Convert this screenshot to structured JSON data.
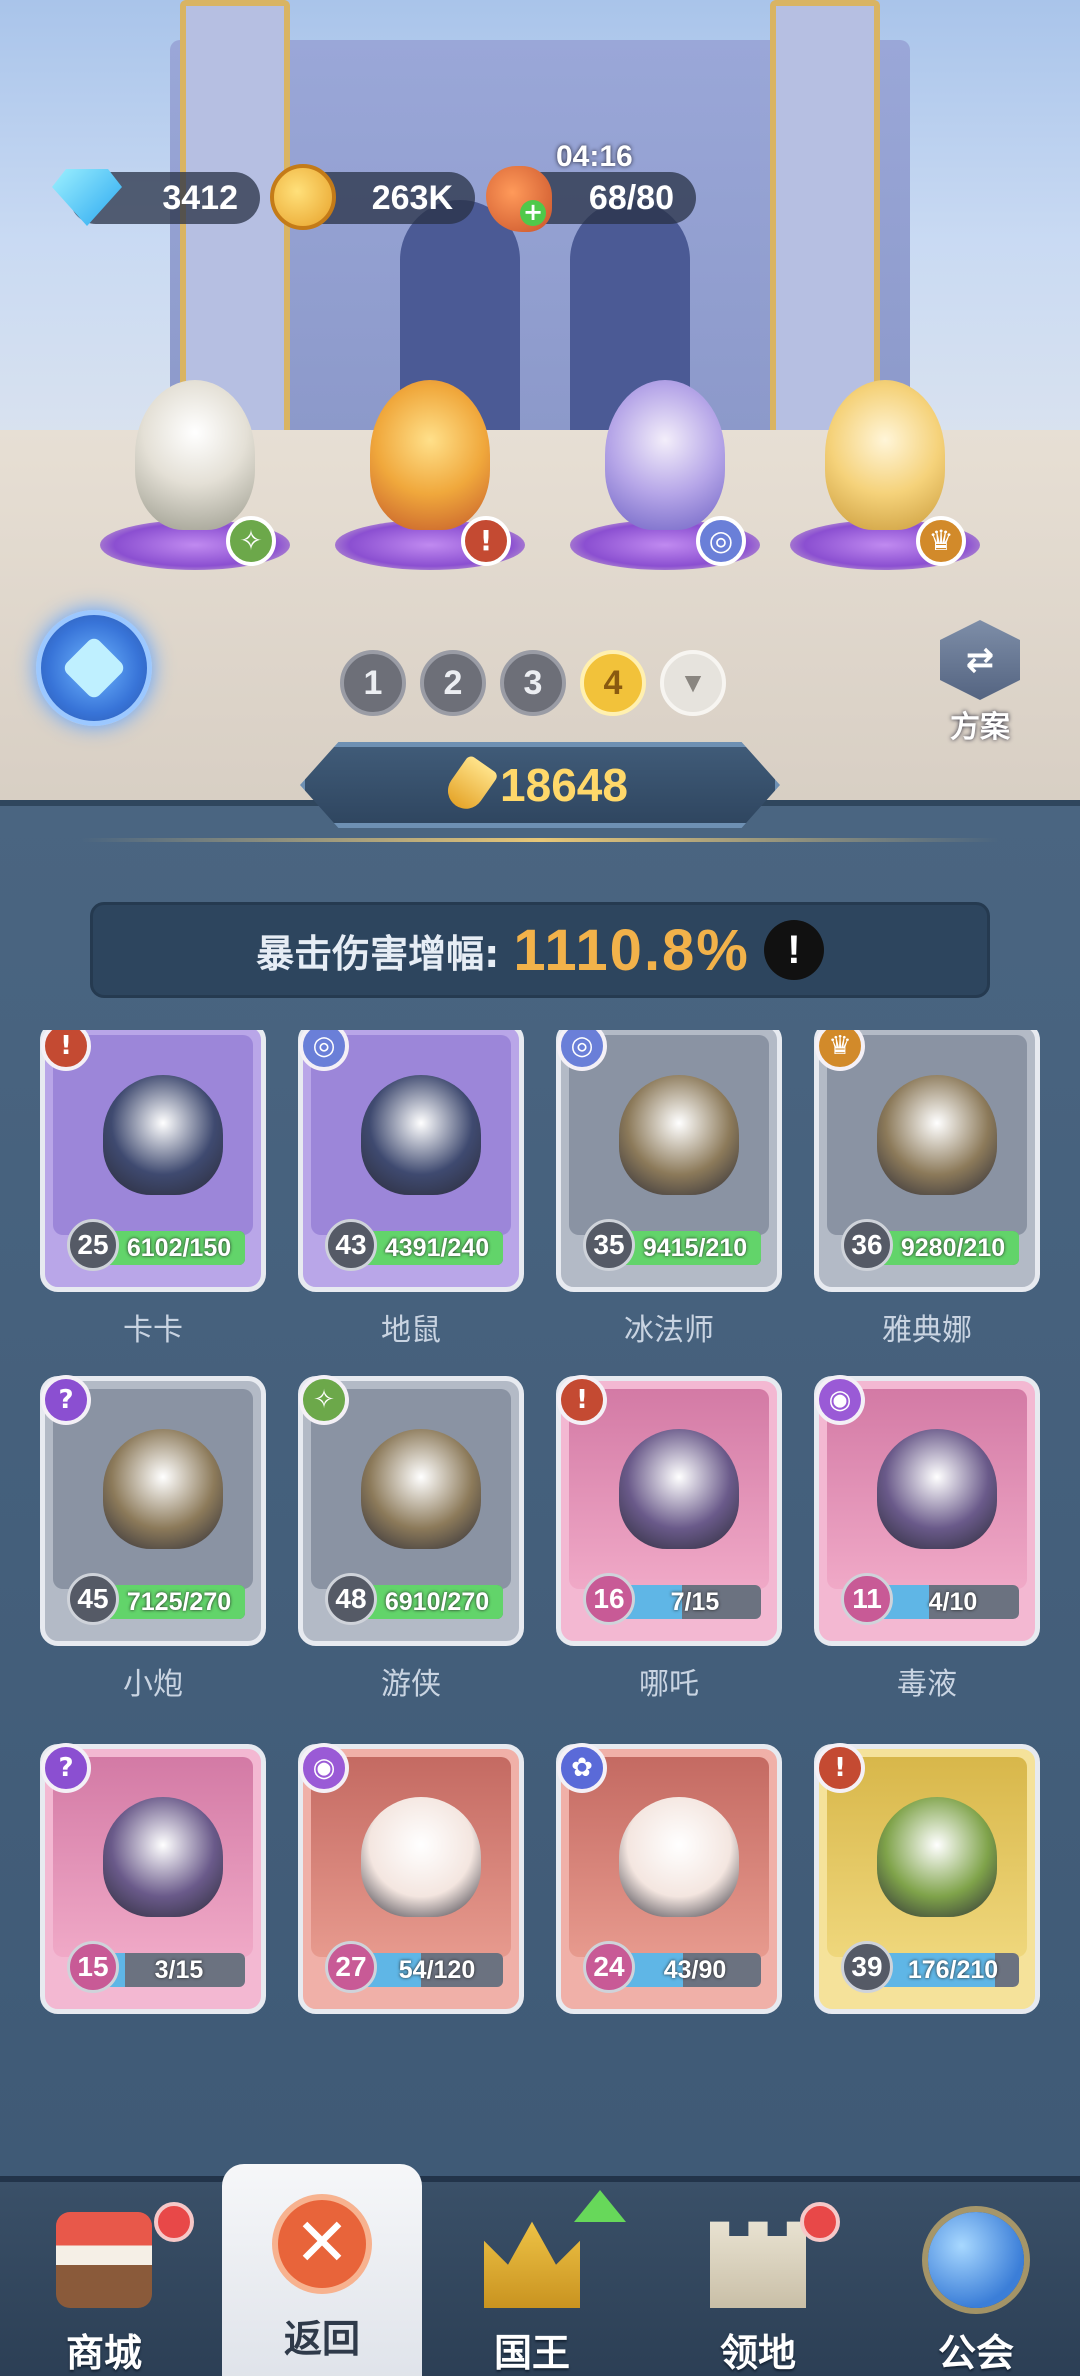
{
  "resources": {
    "gems": "3412",
    "gold": "263K",
    "stamina": "68/80",
    "stamina_timer": "04:16"
  },
  "lineup": [
    {
      "badge_icon": "ranger-class-icon",
      "badge_glyph": "✧"
    },
    {
      "badge_icon": "warrior-class-icon",
      "badge_glyph": "!"
    },
    {
      "badge_icon": "mage-class-icon",
      "badge_glyph": "◎"
    },
    {
      "badge_icon": "support-class-icon",
      "badge_glyph": "♛"
    }
  ],
  "team_tabs": [
    "1",
    "2",
    "3",
    "4"
  ],
  "active_team": "4",
  "plan_button": {
    "label": "方案",
    "icon": "plan-swap-icon"
  },
  "power": "18648",
  "stat": {
    "label": "暴击伤害增幅:",
    "value": "1110.8%",
    "info": "!"
  },
  "cards": [
    {
      "name": "卡卡",
      "level": "25",
      "progress": "6102/150",
      "fill": 1.0,
      "rarity": "purple",
      "badge": "!",
      "badge_color": "#c44a32"
    },
    {
      "name": "地鼠",
      "level": "43",
      "progress": "4391/240",
      "fill": 1.0,
      "rarity": "purple",
      "badge": "◎",
      "badge_color": "#6a7fd8"
    },
    {
      "name": "冰法师",
      "level": "35",
      "progress": "9415/210",
      "fill": 1.0,
      "rarity": "gray",
      "badge": "◎",
      "badge_color": "#6a7fd8"
    },
    {
      "name": "雅典娜",
      "level": "36",
      "progress": "9280/210",
      "fill": 1.0,
      "rarity": "gray",
      "badge": "♛",
      "badge_color": "#d28a2a"
    },
    {
      "name": "小炮",
      "level": "45",
      "progress": "7125/270",
      "fill": 1.0,
      "rarity": "gray",
      "badge": "?",
      "badge_color": "#8b4fd1"
    },
    {
      "name": "游侠",
      "level": "48",
      "progress": "6910/270",
      "fill": 1.0,
      "rarity": "gray",
      "badge": "✧",
      "badge_color": "#6ca84a"
    },
    {
      "name": "哪吒",
      "level": "16",
      "progress": "7/15",
      "fill": 0.47,
      "rarity": "pink",
      "badge": "!",
      "badge_color": "#c44a32"
    },
    {
      "name": "毒液",
      "level": "11",
      "progress": "4/10",
      "fill": 0.4,
      "rarity": "pink",
      "badge": "◉",
      "badge_color": "#9a5ad6"
    },
    {
      "name": "",
      "level": "15",
      "progress": "3/15",
      "fill": 0.2,
      "rarity": "pink",
      "badge": "?",
      "badge_color": "#8b4fd1"
    },
    {
      "name": "",
      "level": "27",
      "progress": "54/120",
      "fill": 0.45,
      "rarity": "red",
      "badge": "◉",
      "badge_color": "#9a5ad6"
    },
    {
      "name": "",
      "level": "24",
      "progress": "43/90",
      "fill": 0.48,
      "rarity": "red",
      "badge": "✿",
      "badge_color": "#5a6ad8"
    },
    {
      "name": "",
      "level": "39",
      "progress": "176/210",
      "fill": 0.84,
      "rarity": "gold",
      "badge": "!",
      "badge_color": "#c44a32"
    }
  ],
  "nav": [
    {
      "label": "商城",
      "icon": "shop-icon",
      "dot": true
    },
    {
      "label": "返回",
      "icon": "close-icon",
      "active": true
    },
    {
      "label": "国王",
      "icon": "crown-icon",
      "upgrade": true
    },
    {
      "label": "领地",
      "icon": "castle-icon",
      "dot": true
    },
    {
      "label": "公会",
      "icon": "planet-icon"
    }
  ]
}
